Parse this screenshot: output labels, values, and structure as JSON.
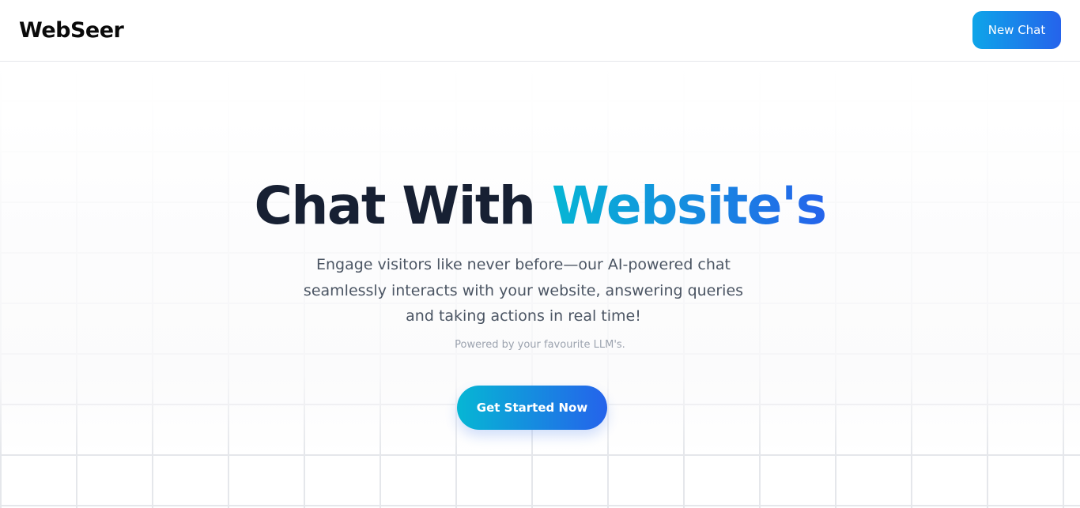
{
  "header": {
    "brand": "WebSeer",
    "new_chat_label": "New Chat"
  },
  "hero": {
    "title_main": "Chat With ",
    "title_accent": "Website's",
    "subtitle": "Engage visitors like never before—our AI-powered chat seamlessly interacts with your website, answering queries and taking actions in real time!",
    "powered_by": "Powered by your favourite LLM's.",
    "cta_label": "Get Started Now"
  },
  "colors": {
    "accent_start": "#06b6d4",
    "accent_end": "#2563eb",
    "title_dark": "#172033",
    "body_text": "#4b5563",
    "muted_text": "#9ca3af"
  }
}
